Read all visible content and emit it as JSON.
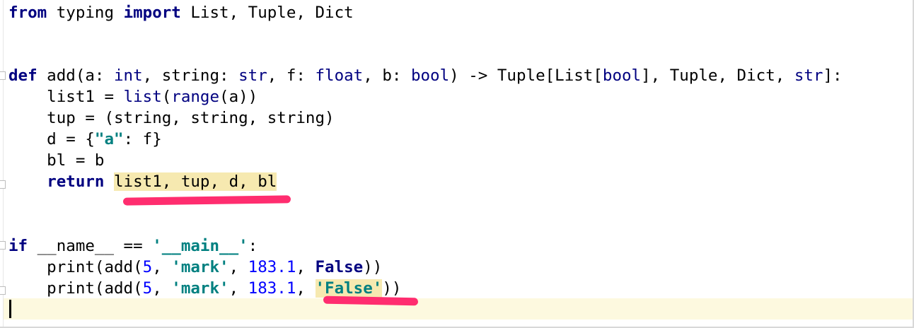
{
  "editor": {
    "language": "python",
    "colors": {
      "keyword": "#000080",
      "builtin": "#000080",
      "string": "#008080",
      "number": "#0000ff",
      "highlight": "#f6e9b0",
      "caret_line": "#fdf9df",
      "annotation": "#ff2d6f"
    },
    "lines": {
      "l1": {
        "kw_from": "from",
        "t1": " typing ",
        "kw_import": "import",
        "t2": " List, Tuple, Dict"
      },
      "l2": {
        "kw_def": "def",
        "t1": " add(a: ",
        "int": "int",
        "t2": ", string: ",
        "str1": "str",
        "t3": ", f: ",
        "float": "float",
        "t4": ", b: ",
        "bool1": "bool",
        "t5": ") -> Tuple[List[",
        "bool2": "bool",
        "t6": "], Tuple, Dict, ",
        "str2": "str",
        "t7": "]:"
      },
      "l3": {
        "t1": "    list1 = ",
        "list": "list",
        "t2": "(",
        "range": "range",
        "t3": "(a))"
      },
      "l4": {
        "t1": "    tup = (string, string, string)"
      },
      "l5": {
        "t1": "    d = {",
        "s": "\"a\"",
        "t2": ": f}"
      },
      "l6": {
        "t1": "    bl = b"
      },
      "l7": {
        "t1": "    ",
        "kw_return": "return",
        "t2": " ",
        "ret_value": "list1, tup, d, bl"
      },
      "l8": {
        "kw_if": "if",
        "t1": " __name__ == ",
        "s": "'__main__'",
        "t2": ":"
      },
      "l9": {
        "t1": "    print(add(",
        "n1": "5",
        "t2": ", ",
        "s": "'mark'",
        "t3": ", ",
        "n2": "183.1",
        "t4": ", ",
        "kw_false": "False",
        "t5": "))"
      },
      "l10": {
        "t1": "    print(add(",
        "n1": "5",
        "t2": ", ",
        "s": "'mark'",
        "t3": ", ",
        "n2": "183.1",
        "t4": ", ",
        "s_false": "'False'",
        "t5": "))"
      }
    }
  }
}
